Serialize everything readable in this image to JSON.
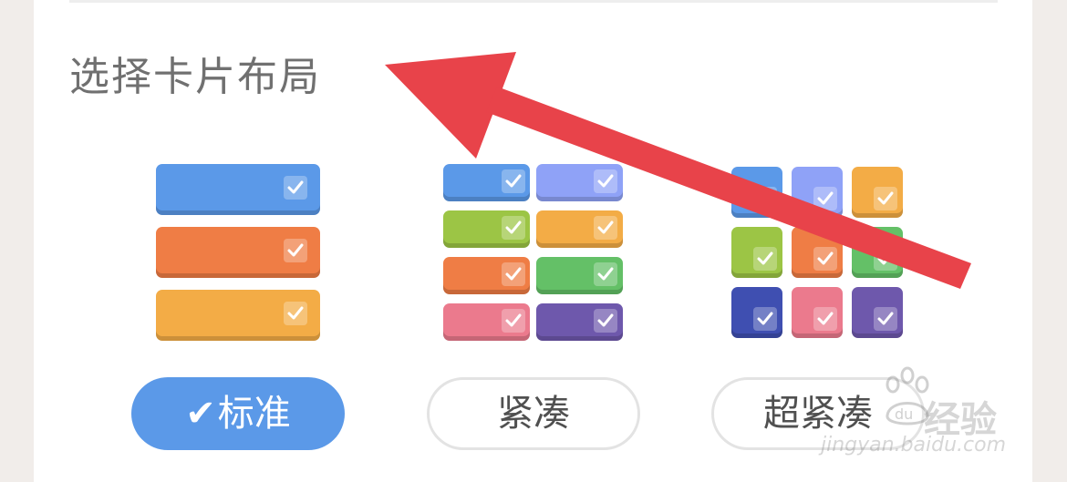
{
  "section": {
    "title": "选择卡片布局"
  },
  "colors": {
    "accent": "#5b99e8",
    "arrow": "#e8434a",
    "blue": "#5b99e8",
    "orange": "#ef7d45",
    "amber": "#f3ac46",
    "lavender": "#8fa2f7",
    "green_olive": "#9cc545",
    "green": "#64c067",
    "pink": "#eb7a8d",
    "purple": "#6e58ac",
    "navy": "#3f4fb1"
  },
  "layouts": [
    {
      "id": "standard",
      "label": "标准",
      "selected": true,
      "check_glyph": "✔",
      "preview_icon": "list-layout-preview-icon"
    },
    {
      "id": "compact",
      "label": "紧凑",
      "selected": false,
      "preview_icon": "two-column-layout-preview-icon"
    },
    {
      "id": "super_compact",
      "label": "超紧凑",
      "selected": false,
      "preview_icon": "grid-layout-preview-icon"
    }
  ],
  "watermark": {
    "brand": "经验",
    "logo_text": "du",
    "url": "jingyan.baidu.com"
  }
}
